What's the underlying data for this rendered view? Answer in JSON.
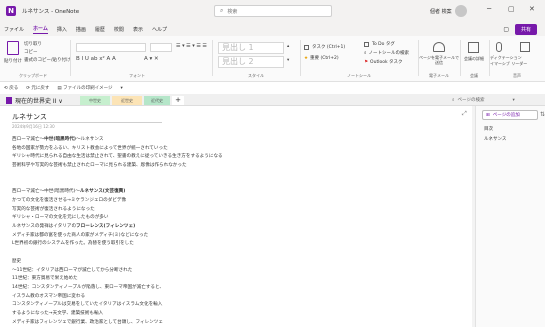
{
  "window": {
    "app_icon": "N",
    "title": "ルネサンス - OneNote",
    "search_placeholder": "検索",
    "user_name": "個者 検案",
    "min": "─",
    "max": "▢",
    "close": "✕"
  },
  "menu": {
    "items": [
      "ファイル",
      "ホーム",
      "挿入",
      "描画",
      "履歴",
      "校閲",
      "表示",
      "ヘルプ"
    ],
    "active_index": 1,
    "share_label": "共有",
    "mode_icon": "▢"
  },
  "ribbon": {
    "clipboard": {
      "paste": "貼り付け",
      "cut": "切り取り",
      "copy": "コピー",
      "format": "書式のコピー/貼り付け",
      "label": "クリップボード"
    },
    "font": {
      "format_row": "B  I  U  ab  x²  A  A",
      "label": "フォント"
    },
    "basic_text": {
      "bullets": "☰ ▾  ☰ ▾  ☰ ☰",
      "clear": "A ▾  ✕"
    },
    "styles": {
      "heading1": "見出し 1",
      "heading2": "見出し 2",
      "label": "スタイル"
    },
    "tags": {
      "todo": "タスク (Ctrl+1)",
      "important": "重要 (Ctrl+2)",
      "todo_tag": "To Do タグ",
      "find_tags": "ノートシールの検索",
      "outlook": "Outlook タスク",
      "label": "ノートシール"
    },
    "email": {
      "btn": "ページを電子メールで送信",
      "label": "電子メール"
    },
    "meetings": {
      "btn": "会議の詳細",
      "label": "会議"
    },
    "voice": {
      "btn1": "ディクテーション",
      "btn2": "イマーシブ リーダー",
      "label": "音声"
    }
  },
  "quickbar": {
    "items": [
      "⟲ 戻る",
      "⟳ 元に戻す",
      "▤ ファイルの印刷イメージ",
      "▾"
    ]
  },
  "tabs": {
    "notebook": "現在的世界史 II ∨",
    "sections": [
      {
        "label": "中世史",
        "color": "#c6efce"
      },
      {
        "label": "近世史",
        "color": "#fce4b6"
      },
      {
        "label": "近代史",
        "color": "#b5e6c9"
      }
    ],
    "plus": "+",
    "page_search": "ページの検索"
  },
  "page": {
    "title": "ルネサンス",
    "date": "2024年9月16日   12:30",
    "lines": [
      {
        "pre": "西ローマ滅亡～",
        "bold": "中世(暗黒時代)",
        "post": "～ルネサンス"
      },
      {
        "pre": "各地の国家が勢力をふるい、キリスト教会によって世界が統一されていった",
        "bold": "",
        "post": ""
      },
      {
        "pre": "ギリシャ時代に見られる自由な生活は禁止されて、聖書の教えに従っていきる生き方をするようになる",
        "bold": "",
        "post": ""
      },
      {
        "pre": "芸術科学や写実的な芸術も禁止されたローマに見られる建築、彫像は作られなかった",
        "bold": "",
        "post": ""
      },
      {
        "pre": "",
        "bold": "",
        "post": ""
      },
      {
        "pre": "",
        "bold": "",
        "post": ""
      },
      {
        "pre": "西ローマ滅亡～中世(暗黒時代)～",
        "bold": "ルネサンス(文芸復興)",
        "post": ""
      },
      {
        "pre": "かつての文化を復活させる→ミケランジェロのダビデ像",
        "bold": "",
        "post": ""
      },
      {
        "pre": "写実的な芸術が復活されるようになった",
        "bold": "",
        "post": ""
      },
      {
        "pre": "ギリシャ・ローマの文化を元にしたものが多い",
        "bold": "",
        "post": ""
      },
      {
        "pre": "ルネサンスの発祥はイタリアの",
        "bold": "フローレンス(フィレンツェ)",
        "post": ""
      },
      {
        "pre": "メディチ家は都の富を使った商人の家がメディチ(ミ)などになった",
        "bold": "",
        "post": ""
      },
      {
        "pre": "L世界初の銀行のシステムを作った。為替を使う取引をした",
        "bold": "",
        "post": ""
      },
      {
        "pre": "",
        "bold": "",
        "post": ""
      },
      {
        "pre": "歴史",
        "bold": "",
        "post": ""
      },
      {
        "pre": "～11世紀：イタリアは西ローマが滅亡してから分断された",
        "bold": "",
        "post": ""
      },
      {
        "pre": "11世紀：東方貿易で栄え始めた",
        "bold": "",
        "post": ""
      },
      {
        "pre": "14世紀：コンスタンティノープルが陥落し、東ローマ帝国が滅亡すると、",
        "bold": "",
        "post": ""
      },
      {
        "pre": "イスラム教のオスマン帝国に変わる",
        "bold": "",
        "post": ""
      },
      {
        "pre": "コンスタンティノープルは交易をしていたイタリアはイスラム文化を輸入",
        "bold": "",
        "post": ""
      },
      {
        "pre": "するようになった→天文学、建築技術も輸入",
        "bold": "",
        "post": ""
      },
      {
        "pre": "メディチ家はフィレンツェで銀行業、政治家として台頭し、フィレンツェ",
        "bold": "",
        "post": ""
      }
    ]
  },
  "pages_panel": {
    "add_label": "ページの追加",
    "sort_icon": "⇅",
    "items": [
      "目次",
      "ルネサンス"
    ]
  }
}
